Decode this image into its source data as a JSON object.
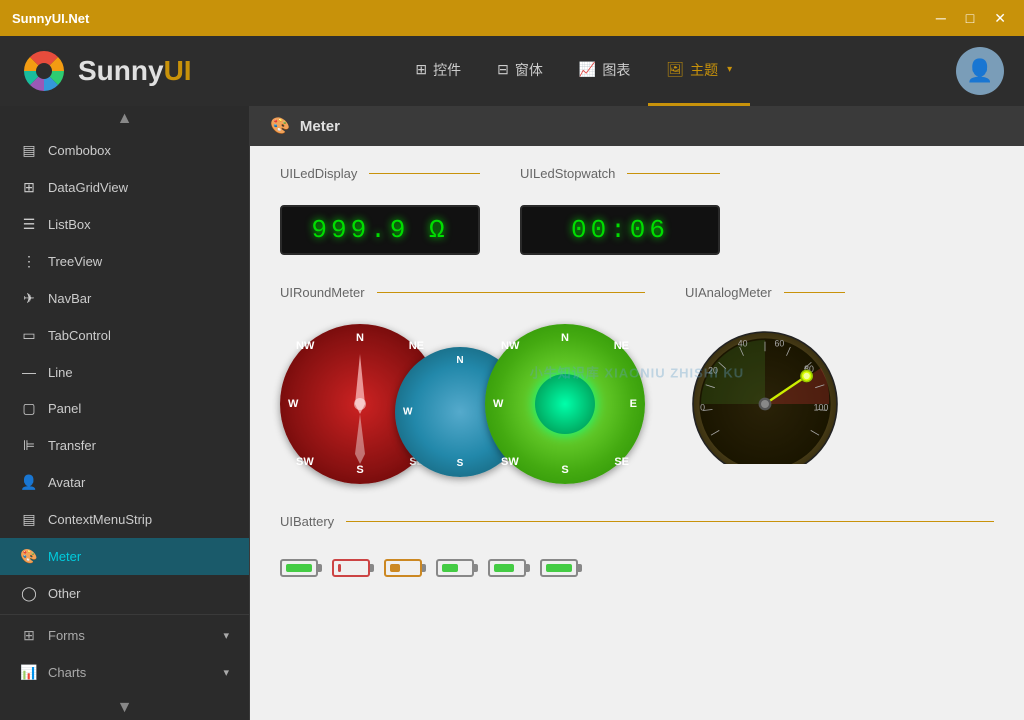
{
  "titlebar": {
    "title": "SunnyUI.Net",
    "min_btn": "─",
    "max_btn": "□",
    "close_btn": "✕"
  },
  "header": {
    "logo_text_black": "Sunny",
    "logo_text_orange": "UI",
    "nav": [
      {
        "label": "控件",
        "icon": "⊞",
        "active": false
      },
      {
        "label": "窗体",
        "icon": "⊟",
        "active": false
      },
      {
        "label": "图表",
        "icon": "📈",
        "active": false
      },
      {
        "label": "主题",
        "icon": "🖼",
        "active": true,
        "has_dropdown": true
      }
    ]
  },
  "sidebar": {
    "items": [
      {
        "label": "Combobox",
        "icon": "▤",
        "active": false
      },
      {
        "label": "DataGridView",
        "icon": "⊞",
        "active": false
      },
      {
        "label": "ListBox",
        "icon": "☰",
        "active": false
      },
      {
        "label": "TreeView",
        "icon": "⋮=",
        "active": false
      },
      {
        "label": "NavBar",
        "icon": "✈",
        "active": false
      },
      {
        "label": "TabControl",
        "icon": "▭",
        "active": false
      },
      {
        "label": "Line",
        "icon": "—",
        "active": false
      },
      {
        "label": "Panel",
        "icon": "▢",
        "active": false
      },
      {
        "label": "Transfer",
        "icon": "⊫",
        "active": false
      },
      {
        "label": "Avatar",
        "icon": "👤",
        "active": false
      },
      {
        "label": "ContextMenuStrip",
        "icon": "▤",
        "active": false
      },
      {
        "label": "Meter",
        "icon": "🎨",
        "active": true
      },
      {
        "label": "Other",
        "icon": "◯",
        "active": false
      }
    ],
    "sections": [
      {
        "label": "Forms",
        "icon": "⊞",
        "active": false
      },
      {
        "label": "Charts",
        "icon": "📊",
        "active": false
      }
    ]
  },
  "content": {
    "header_icon": "🎨",
    "header_title": "Meter",
    "sections": [
      {
        "title": "UILedDisplay",
        "value": "999.9 Ω"
      },
      {
        "title": "UILedStopwatch",
        "value": "00:06"
      },
      {
        "title": "UIRoundMeter"
      },
      {
        "title": "UIAnalogMeter"
      },
      {
        "title": "UIBattery"
      }
    ],
    "watermark": "小牛知识库 XIAONIU ZHISHI KU"
  },
  "colors": {
    "accent": "#c8920a",
    "sidebar_bg": "#2b2b2b",
    "active_item_bg": "#1a5a6a",
    "active_item_color": "#00ccdd"
  }
}
